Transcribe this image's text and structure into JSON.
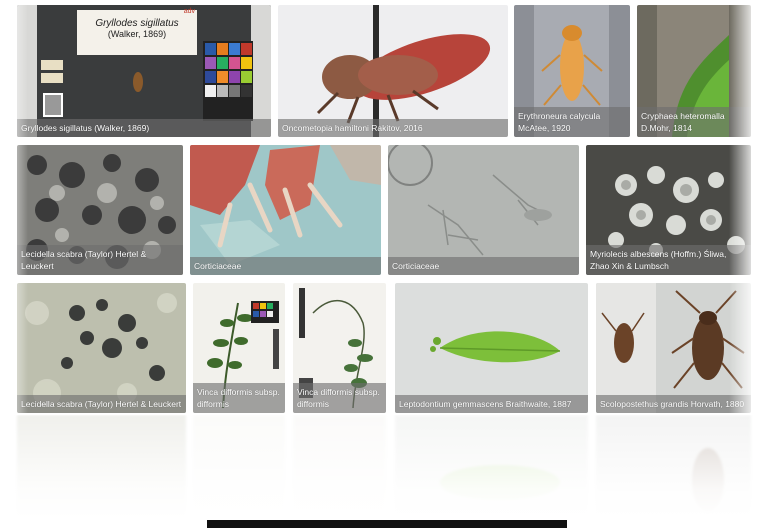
{
  "gallery": {
    "tiles": [
      {
        "caption": "Gryllodes sigillatus (Walker, 1869)",
        "label_title": "Gryllodes sigillatus",
        "label_sub": "(Walker, 1869)",
        "label_corner": "adv"
      },
      {
        "caption": "Oncometopia hamiltoni Rakitov, 2016"
      },
      {
        "caption": "Erythroneura calycula McAtee, 1920"
      },
      {
        "caption": "Cryphaea heteromalla D.Mohr, 1814"
      },
      {
        "caption": "Lecidella scabra (Taylor) Hertel & Leuckert"
      },
      {
        "caption": "Corticiaceae"
      },
      {
        "caption": "Corticiaceae"
      },
      {
        "caption": "Myriolecis albescens (Hoffm.) Śliwa, Zhao Xin & Lumbsch"
      },
      {
        "caption": "Lecidella scabra (Taylor) Hertel & Leuckert"
      },
      {
        "caption": "Vinca difformis subsp. difformis"
      },
      {
        "caption": "Vinca difformis subsp. difformis"
      },
      {
        "caption": "Leptodontium gemmascens Braithwaite, 1887"
      },
      {
        "caption": "Scolopostethus grandis Horvath, 1880"
      }
    ]
  }
}
